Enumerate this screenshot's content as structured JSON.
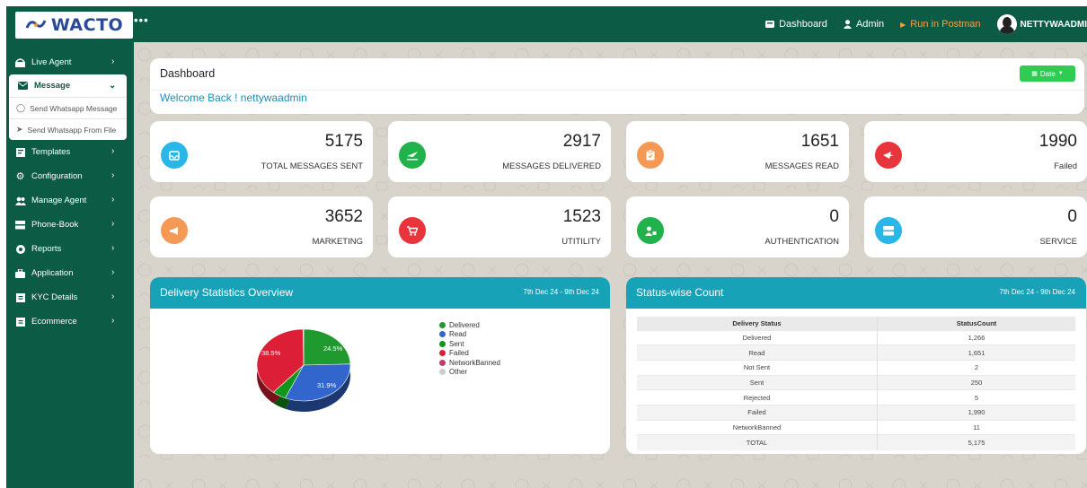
{
  "brand": {
    "name": "WACTO",
    "more": "•••"
  },
  "topnav": {
    "dashboard": "Dashboard",
    "admin": "Admin",
    "postman": "Run in Postman",
    "user": "NETTYWAADMI"
  },
  "sidebar": {
    "items": [
      {
        "label": "Live Agent",
        "icon": "headset-icon"
      },
      {
        "label": "Message",
        "icon": "message-icon"
      },
      {
        "label": "Templates",
        "icon": "template-icon"
      },
      {
        "label": "Configuration",
        "icon": "gear-icon"
      },
      {
        "label": "Manage Agent",
        "icon": "users-icon"
      },
      {
        "label": "Phone-Book",
        "icon": "phonebook-icon"
      },
      {
        "label": "Reports",
        "icon": "reports-icon"
      },
      {
        "label": "Application",
        "icon": "application-icon"
      },
      {
        "label": "KYC Details",
        "icon": "kyc-icon"
      },
      {
        "label": "Ecommerce",
        "icon": "ecommerce-icon"
      }
    ],
    "message_sub": [
      {
        "label": "Send Whatsapp Message",
        "icon": "whatsapp-icon"
      },
      {
        "label": "Send Whatsapp From File",
        "icon": "send-icon"
      }
    ]
  },
  "header": {
    "title": "Dashboard",
    "welcome": "Welcome Back ! nettywaadmin",
    "date_button": "Date"
  },
  "stats": [
    {
      "value": "5175",
      "label": "TOTAL MESSAGES SENT",
      "color": "#29b6e8",
      "icon": "inbox-icon"
    },
    {
      "value": "2917",
      "label": "MESSAGES DELIVERED",
      "color": "#21b24c",
      "icon": "plane-icon"
    },
    {
      "value": "1651",
      "label": "MESSAGES READ",
      "color": "#f59a56",
      "icon": "clipboard-icon"
    },
    {
      "value": "1990",
      "label": "Failed",
      "color": "#e8343b",
      "icon": "plane-off-icon"
    },
    {
      "value": "3652",
      "label": "MARKETING",
      "color": "#f59a56",
      "icon": "megaphone-icon"
    },
    {
      "value": "1523",
      "label": "UTITILITY",
      "color": "#e8343b",
      "icon": "cart-icon"
    },
    {
      "value": "0",
      "label": "AUTHENTICATION",
      "color": "#21b24c",
      "icon": "user-lock-icon"
    },
    {
      "value": "0",
      "label": "SERVICE",
      "color": "#29b6e8",
      "icon": "server-icon"
    }
  ],
  "delivery_panel": {
    "title": "Delivery Statistics Overview",
    "range": "7th Dec 24 - 9th Dec 24",
    "slice_labels": [
      "24.5%",
      "31.9%",
      "38.5%"
    ]
  },
  "chart_data": {
    "type": "pie",
    "categories": [
      "Delivered",
      "Read",
      "Sent",
      "Failed",
      "NetworkBanned",
      "Other"
    ],
    "values": [
      24.5,
      31.9,
      4.8,
      38.5,
      0.2,
      0.0
    ],
    "colors": [
      "#1f9a2e",
      "#3366cc",
      "#109618",
      "#dc1f36",
      "#c23b6d",
      "#cccccc"
    ],
    "legend": "right"
  },
  "status_panel": {
    "title": "Status-wise Count",
    "range": "7th Dec 24 - 9th Dec 24",
    "columns": [
      "Delivery Status",
      "StatusCount"
    ],
    "rows": [
      [
        "Delivered",
        "1,266"
      ],
      [
        "Read",
        "1,651"
      ],
      [
        "Not Sent",
        "2"
      ],
      [
        "Sent",
        "250"
      ],
      [
        "Rejected",
        "5"
      ],
      [
        "Failed",
        "1,990"
      ],
      [
        "NetworkBanned",
        "11"
      ],
      [
        "TOTAL",
        "5,175"
      ]
    ]
  }
}
